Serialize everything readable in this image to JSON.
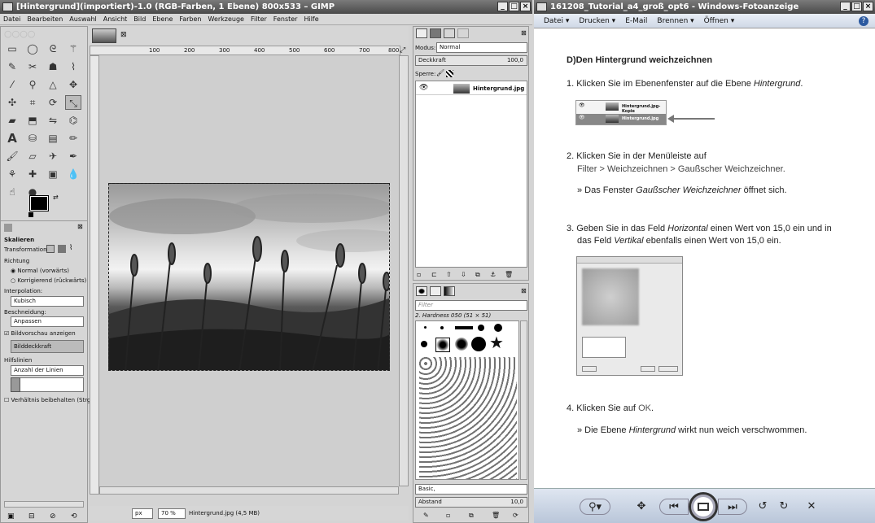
{
  "gimp": {
    "title": "[Hintergrund](importiert)-1.0 (RGB-Farben, 1 Ebene) 800x533 – GIMP",
    "menu": [
      "Datei",
      "Bearbeiten",
      "Auswahl",
      "Ansicht",
      "Bild",
      "Ebene",
      "Farben",
      "Werkzeuge",
      "Filter",
      "Fenster",
      "Hilfe"
    ],
    "ruler_ticks": [
      "100",
      "200",
      "300",
      "400",
      "500",
      "600",
      "700",
      "800"
    ],
    "tool_options": {
      "title": "Skalieren",
      "transformation_label": "Transformation:",
      "richtung_label": "Richtung",
      "normal": "Normal (vorwärts)",
      "korrigierend": "Korrigierend (rückwärts)",
      "interpolation_label": "Interpolation:",
      "interpolation_value": "Kubisch",
      "beschneidung_label": "Beschneidung:",
      "beschneidung_value": "Anpassen",
      "bildvorschau": "Bildvorschau anzeigen",
      "bilddeckkraft": "Bilddeckkraft",
      "hilfslinien_label": "Hilfslinien",
      "hilfslinien_value": "Anzahl der Linien",
      "verhaeltnis": "Verhältnis beibehalten (Strg)"
    },
    "status": {
      "unit": "px",
      "zoom": "70 %",
      "info": "Hintergrund.jpg (4,5 MB)"
    },
    "layers": {
      "modus_label": "Modus:",
      "modus_value": "Normal",
      "deckkraft_label": "Deckkraft",
      "deckkraft_value": "100,0",
      "sperre_label": "Sperre:",
      "layer_name": "Hintergrund.jpg"
    },
    "brushes": {
      "filter_placeholder": "Filter",
      "current": "2. Hardness 050 (51 × 51)",
      "preset": "Basic,",
      "abstand_label": "Abstand",
      "abstand_value": "10,0"
    }
  },
  "viewer": {
    "title": "161208_Tutorial_a4_groß_opt6 - Windows-Fotoanzeige",
    "menu": [
      "Datei ▾",
      "Drucken ▾",
      "E-Mail",
      "Brennen ▾",
      "Öffnen ▾"
    ],
    "heading": "D)Den Hintergrund weichzeichnen",
    "step1": "1. Klicken Sie im Ebenenfenster auf die Ebene ",
    "step1_em": "Hintergrund",
    "step1_end": ".",
    "thumb1_row1": "Hintergrund.jpg-Kopie",
    "thumb1_row2": "Hintergrund.jpg",
    "step2a": "2. Klicken Sie in der Menüleiste auf",
    "step2b": "Filter > Weichzeichnen > Gaußscher Weichzeichner.",
    "step2c_pre": "» Das Fenster ",
    "step2c_em": "Gaußscher Weichzeichner",
    "step2c_post": " öffnet sich.",
    "step3a_pre": "3. Geben Sie in das Feld ",
    "step3a_em": "Horizontal",
    "step3a_post": " einen Wert von 15,0 ein und in",
    "step3b_pre": "das Feld ",
    "step3b_em": "Vertikal",
    "step3b_post": " ebenfalls einen Wert von 15,0 ein.",
    "step4_pre": "4. Klicken Sie auf ",
    "step4_ok": "OK",
    "step4_post": ".",
    "step4b_pre": "» Die Ebene ",
    "step4b_em": "Hintergrund",
    "step4b_post": " wirkt nun weich verschwommen."
  }
}
